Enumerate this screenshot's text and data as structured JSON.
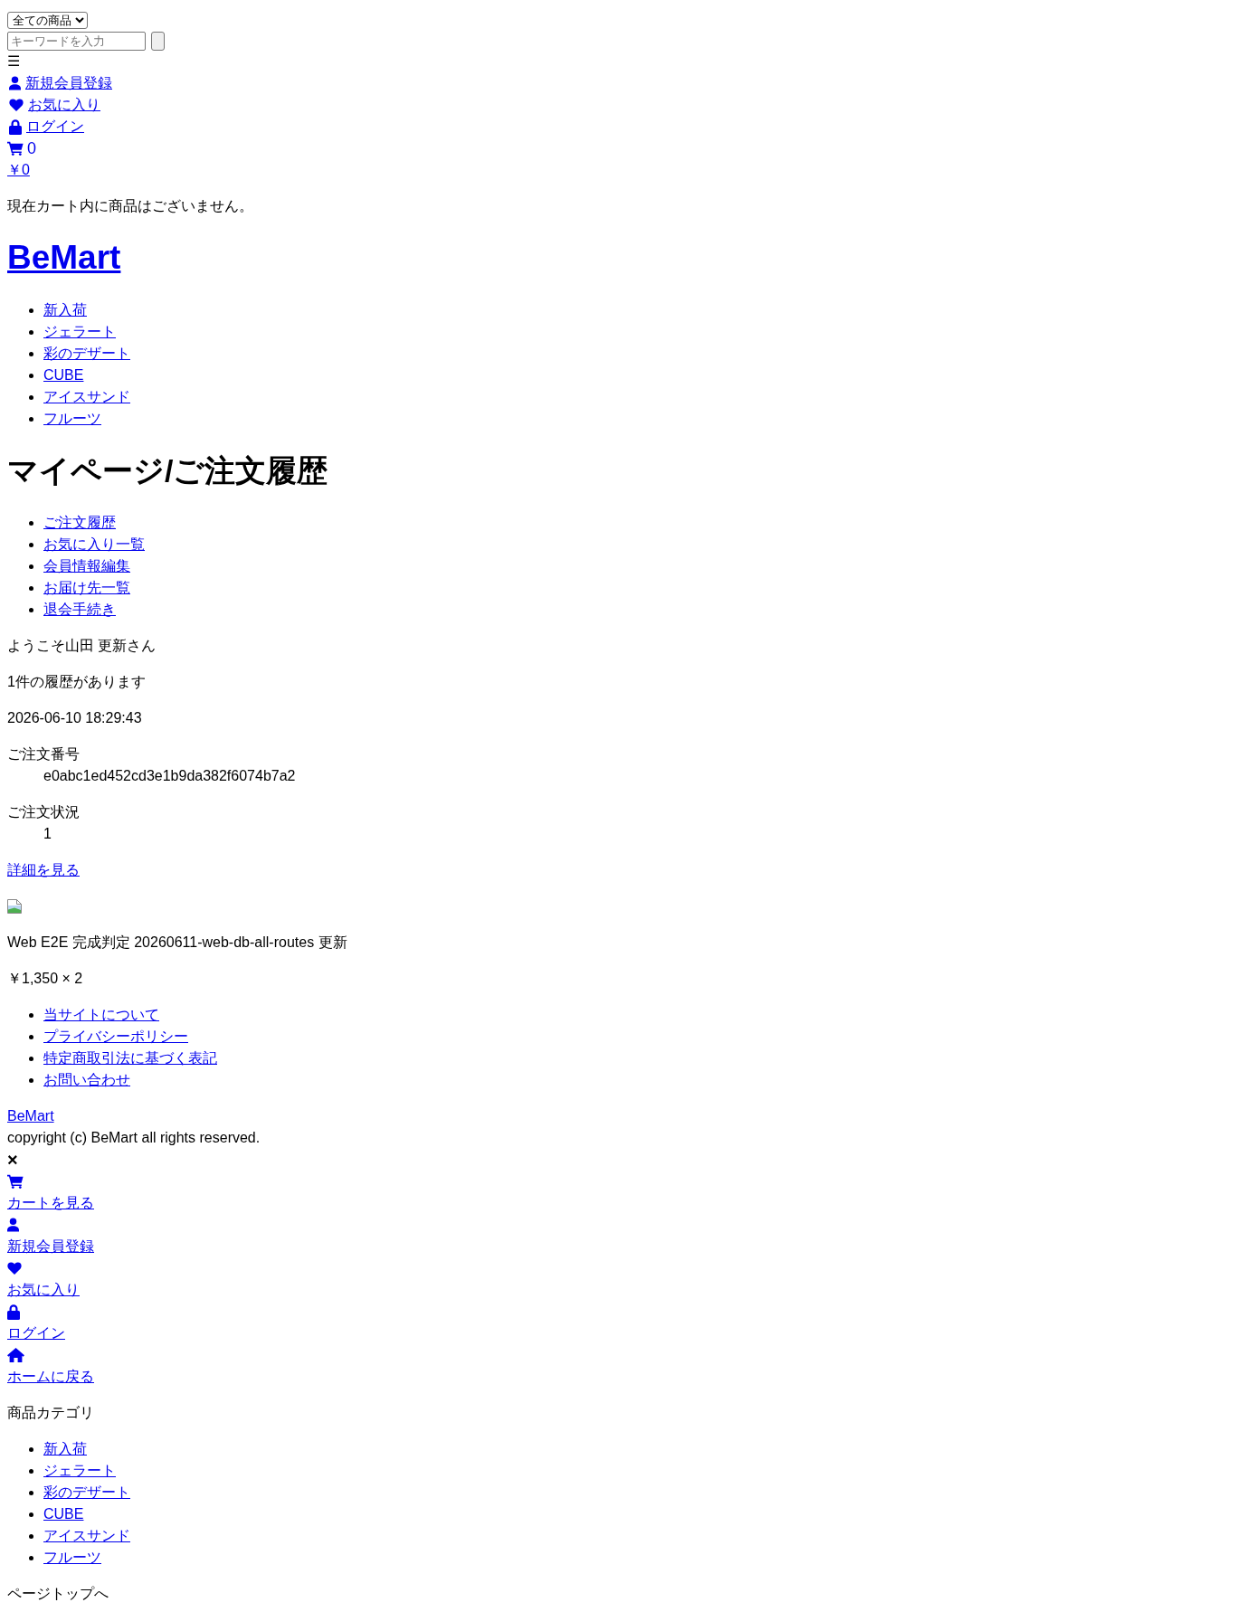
{
  "header": {
    "category_select": {
      "value": "全ての商品"
    },
    "search": {
      "placeholder": "キーワードを入力"
    },
    "menu_toggle": "☰",
    "links": [
      {
        "kind": "signup",
        "label": "新規会員登録"
      },
      {
        "kind": "favorites",
        "label": "お気に入り"
      },
      {
        "kind": "login",
        "label": "ログイン"
      }
    ],
    "cart_count": "0",
    "cart_total": "￥0",
    "cart_message": "現在カート内に商品はございません。"
  },
  "site_title": "BeMart",
  "categories": [
    "新入荷",
    "ジェラート",
    "彩のデザート",
    "CUBE",
    "アイスサンド",
    "フルーツ"
  ],
  "page_title": "マイページ/ご注文履歴",
  "mypage_menu": [
    "ご注文履歴",
    "お気に入り一覧",
    "会員情報編集",
    "お届け先一覧",
    "退会手続き"
  ],
  "welcome": "ようこそ山田 更新さん",
  "history_count": "1件の履歴があります",
  "orders": [
    {
      "date": "2026-06-10 18:29:43",
      "details": [
        {
          "label": "ご注文番号",
          "value": "e0abc1ed452cd3e1b9da382f6074b7a2"
        },
        {
          "label": "ご注文状況",
          "value": "1"
        }
      ],
      "detail_link": "詳細を見る",
      "items": [
        {
          "name": "Web E2E 完成判定 20260611-web-db-all-routes 更新",
          "price": "￥1,350 × 2"
        }
      ]
    }
  ],
  "footer": {
    "links": [
      "当サイトについて",
      "プライバシーポリシー",
      "特定商取引法に基づく表記",
      "お問い合わせ"
    ],
    "brand": "BeMart",
    "copyright": "copyright (c) BeMart all rights reserved."
  },
  "drawer": {
    "close": "×",
    "links": [
      {
        "kind": "cart",
        "label": "カートを見る"
      },
      {
        "kind": "signup",
        "label": "新規会員登録"
      },
      {
        "kind": "favorites",
        "label": "お気に入り"
      },
      {
        "kind": "login",
        "label": "ログイン"
      },
      {
        "kind": "home",
        "label": "ホームに戻る"
      }
    ],
    "category_heading": "商品カテゴリ",
    "categories": [
      "新入荷",
      "ジェラート",
      "彩のデザート",
      "CUBE",
      "アイスサンド",
      "フルーツ"
    ]
  },
  "page_top": "ページトップへ"
}
